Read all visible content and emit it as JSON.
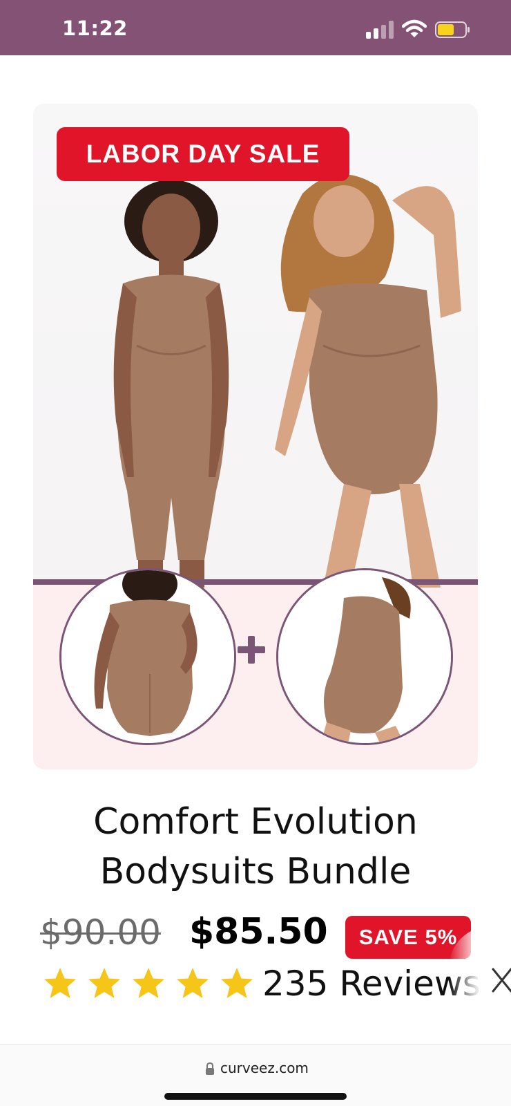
{
  "status_bar": {
    "time": "11:22",
    "background_color": "#835274"
  },
  "product_image": {
    "sale_banner": "LABOR DAY SALE",
    "banner_color": "#e0152a",
    "accent_color": "#7b5575",
    "plus_icon": "plus-icon"
  },
  "product": {
    "title_line1": "Comfort Evolution",
    "title_line2": "Bodysuits Bundle",
    "old_price": "$90.00",
    "new_price": "$85.50",
    "save_badge": "SAVE 5%",
    "rating_stars": 5,
    "star_color": "#f5c518",
    "reviews_label": "235 Reviews"
  },
  "browser": {
    "url": "curveez.com",
    "close_icon": "close-icon",
    "lock_icon": "lock-icon"
  }
}
